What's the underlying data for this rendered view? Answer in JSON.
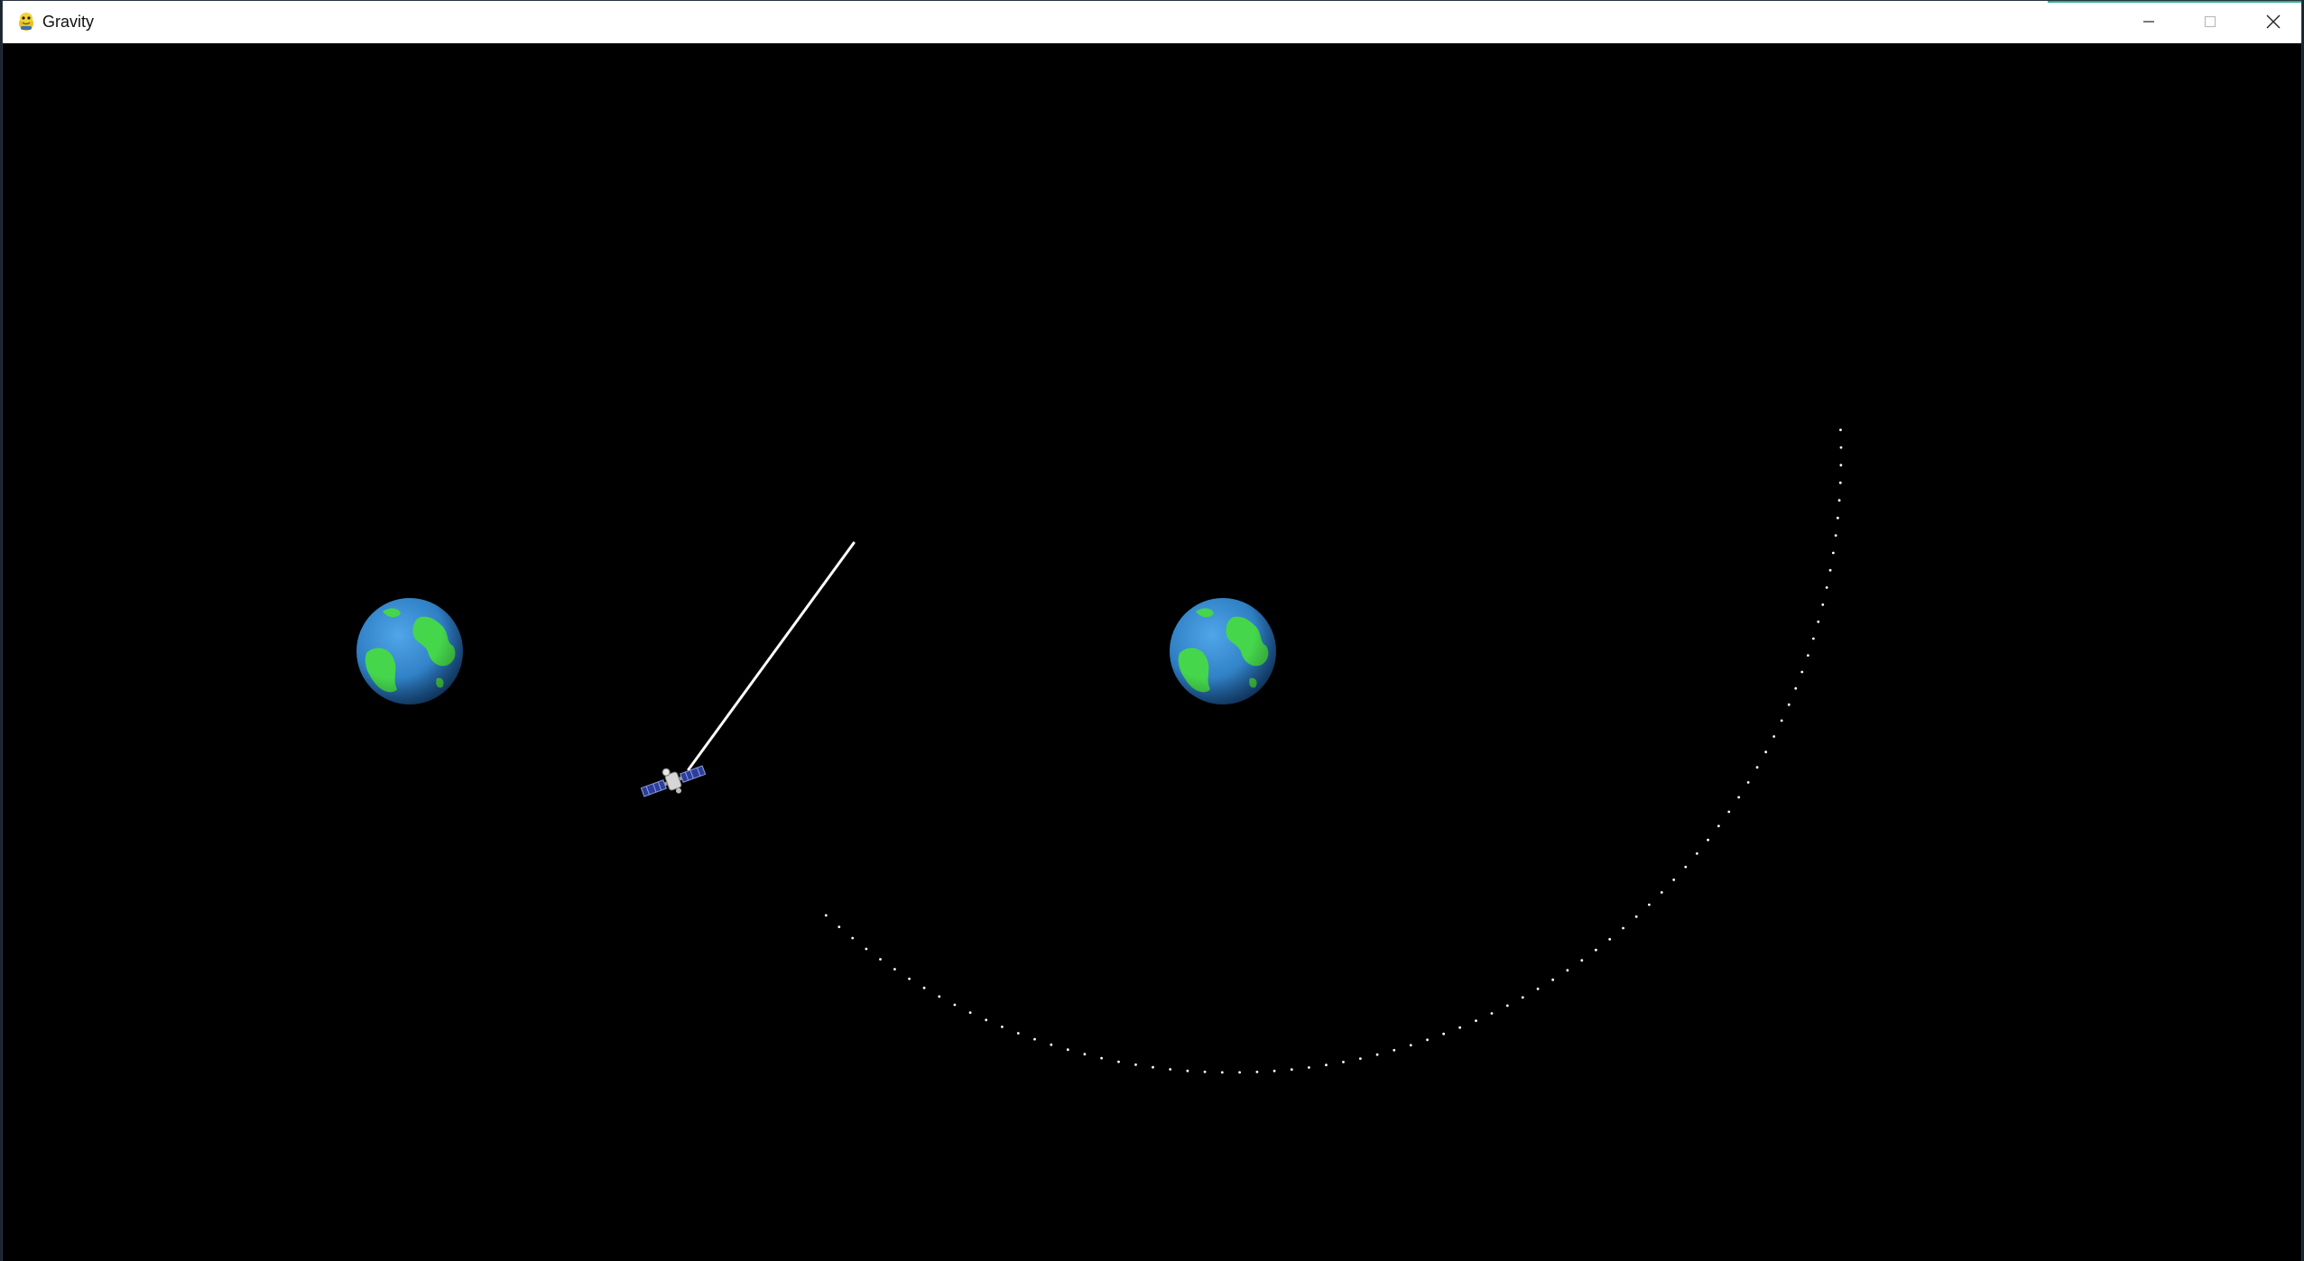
{
  "window": {
    "title": "Gravity",
    "app_icon": "pygame-snake-icon",
    "controls": {
      "minimize_icon": "minimize-icon",
      "maximize_icon": "maximize-icon",
      "close_icon": "close-icon"
    }
  },
  "scene": {
    "background_color": "#000000",
    "bodies": [
      {
        "name": "planet-left",
        "icon": "earth-icon"
      },
      {
        "name": "planet-right",
        "icon": "earth-icon"
      }
    ],
    "satellite": {
      "icon": "satellite-icon"
    },
    "launch_line_color": "#ffffff",
    "trajectory_color": "#ffffff",
    "colors": {
      "ocean": "#2f7fc4",
      "land": "#45d64c",
      "panel": "#2c3e9a"
    }
  }
}
